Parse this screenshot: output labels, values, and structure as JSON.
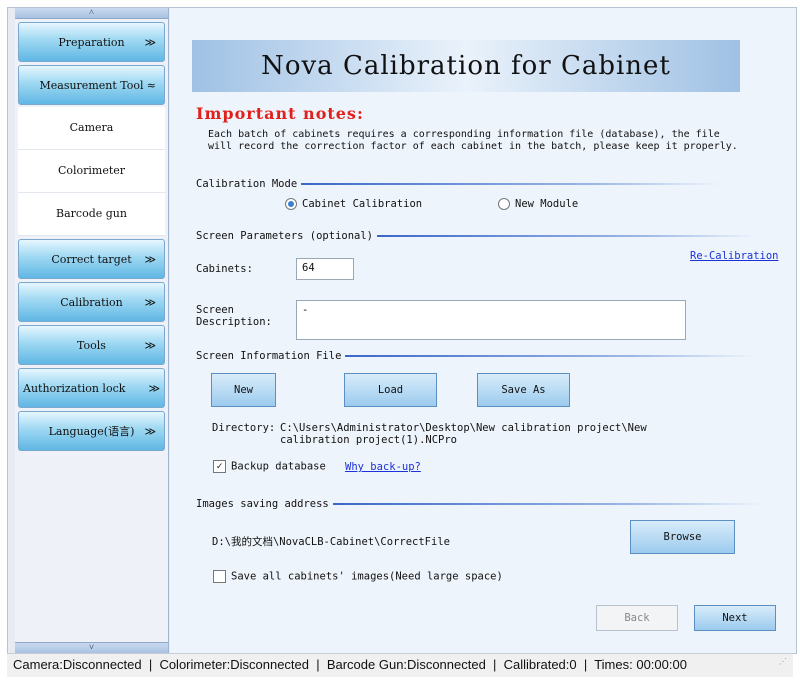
{
  "sidebar": {
    "scroll_up": "˄",
    "scroll_down": "˅",
    "items": [
      {
        "label": "Preparation",
        "chevron": "≫",
        "expanded": false
      },
      {
        "label": "Measurement Tool",
        "chevron": "≈",
        "expanded": true,
        "children": [
          "Camera",
          "Colorimeter",
          "Barcode gun"
        ]
      },
      {
        "label": "Correct target",
        "chevron": "≫",
        "expanded": false
      },
      {
        "label": "Calibration",
        "chevron": "≫",
        "expanded": false
      },
      {
        "label": "Tools",
        "chevron": "≫",
        "expanded": false
      },
      {
        "label": "Authorization lock",
        "chevron": "≫",
        "expanded": false
      },
      {
        "label": "Language(语言)",
        "chevron": "≫",
        "expanded": false
      }
    ]
  },
  "main": {
    "title": "Nova Calibration for Cabinet",
    "notes_title": "Important notes:",
    "notes_text": "Each batch of cabinets requires a corresponding information file (database), the file will record the correction factor of each cabinet in the batch, please keep it properly.",
    "calibration_mode": {
      "label": "Calibration Mode",
      "options": [
        "Cabinet Calibration",
        "New Module"
      ],
      "selected": "Cabinet Calibration"
    },
    "screen_params": {
      "label": "Screen Parameters (optional)",
      "recalibration_link": "Re-Calibration",
      "cabinets_label": "Cabinets:",
      "cabinets_value": "64",
      "description_label": "Screen\nDescription:",
      "description_value": "-"
    },
    "info_file": {
      "label": "Screen Information File",
      "new_button": "New",
      "load_button": "Load",
      "save_as_button": "Save As",
      "directory_label": "Directory:",
      "directory_value": "C:\\Users\\Administrator\\Desktop\\New calibration project\\New calibration project(1).NCPro",
      "backup_label": "Backup database",
      "backup_checked": true,
      "why_backup_link": "Why back-up?"
    },
    "images": {
      "label": "Images saving address",
      "path": "D:\\我的文档\\NovaCLB-Cabinet\\CorrectFile",
      "browse_button": "Browse",
      "save_all_label": "Save all cabinets' images(Need large space)",
      "save_all_checked": false
    },
    "back_button": "Back",
    "next_button": "Next"
  },
  "status_bar": {
    "text": "Camera:Disconnected  |  Colorimeter:Disconnected  |  Barcode Gun:Disconnected  |  Callibrated:0  |  Times: 00:00:00"
  }
}
